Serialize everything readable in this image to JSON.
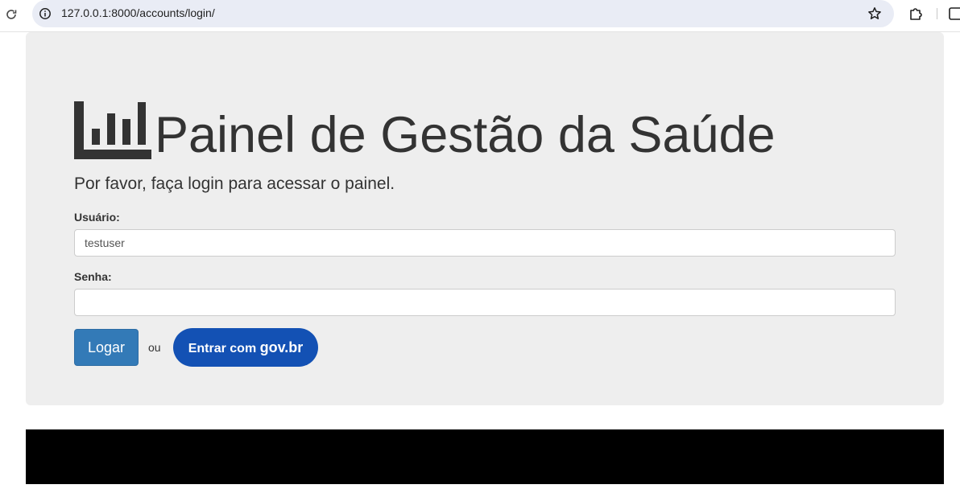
{
  "browser": {
    "url": "127.0.0.1:8000/accounts/login/",
    "icons": {
      "reload": "reload-icon",
      "site_info": "info-icon",
      "bookmark": "star-icon",
      "extensions": "puzzle-icon",
      "side_panel": "side-panel-icon"
    }
  },
  "header": {
    "logo_icon": "bar-chart-icon",
    "title": "Painel de Gestão da Saúde",
    "lead": "Por favor, faça login para acessar o painel."
  },
  "form": {
    "username_label": "Usuário:",
    "username_value": "testuser",
    "password_label": "Senha:",
    "password_value": "",
    "login_button": "Logar",
    "or_text": "ou",
    "govbr_button_prefix": "Entrar com",
    "govbr_button_brand": "gov.br"
  },
  "colors": {
    "jumbotron_bg": "#eeeeee",
    "primary_button": "#337ab7",
    "govbr_button": "#1351b4",
    "footer": "#000000"
  }
}
